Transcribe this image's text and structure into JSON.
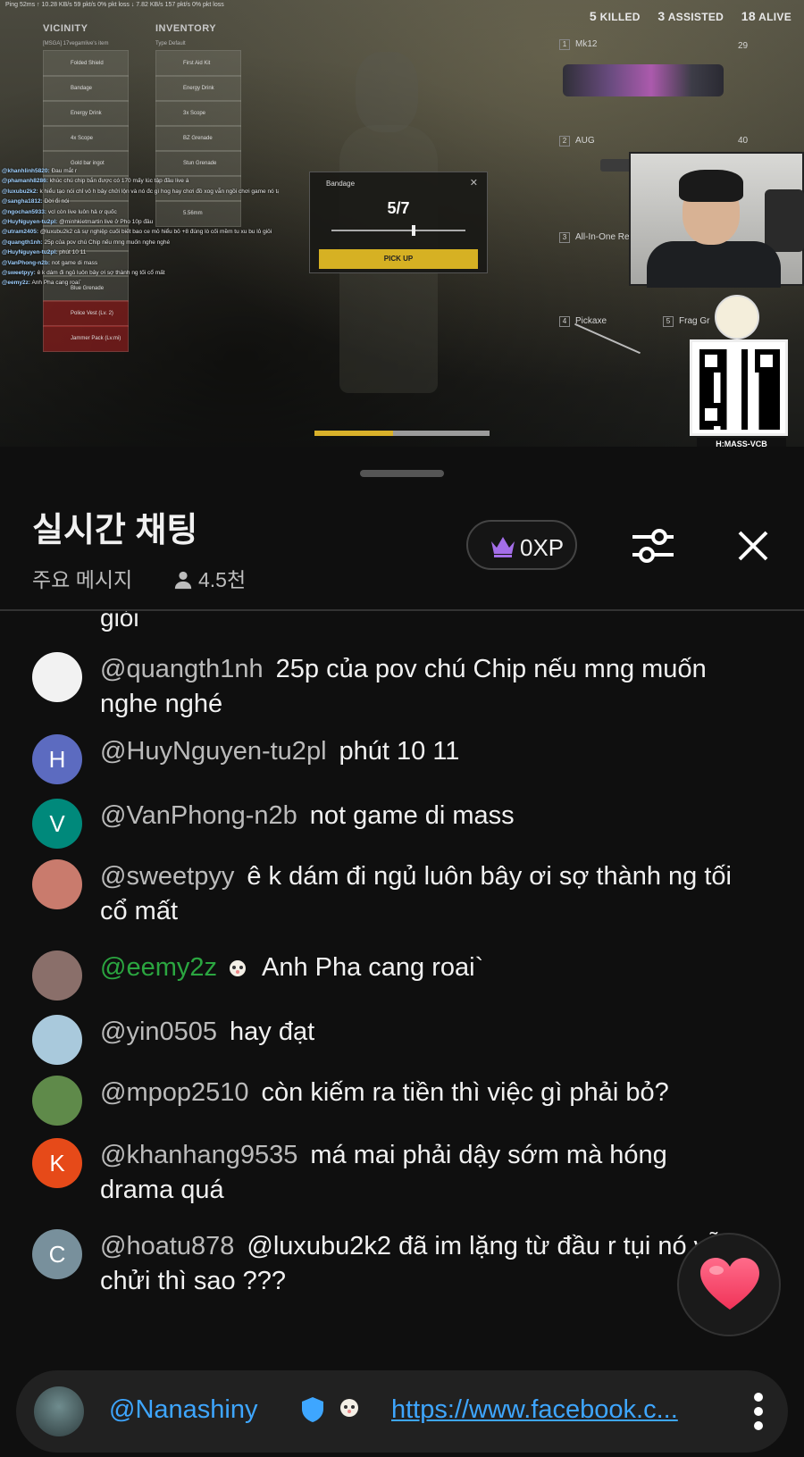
{
  "stream": {
    "hud_top": "Ping 52ms   ↑ 10.28 KB/s  59 pkt/s  0% pkt loss   ↓ 7.82 KB/s  157 pkt/s  0% pkt loss",
    "killed": "5",
    "killed_label": "KILLED",
    "assisted": "3",
    "assisted_label": "ASSISTED",
    "alive": "18",
    "alive_label": "ALIVE",
    "vicinity_title": "VICINITY",
    "vicinity_sub": "[MSGA] 17vegamlive's item",
    "inventory_title": "INVENTORY",
    "inventory_sub": "Type  Default",
    "vicinity_items": [
      "Folded Shield",
      "Bandage",
      "Energy Drink",
      "4x Scope",
      "Gold bar ingot",
      "",
      "",
      "",
      "",
      "Blue Grenade",
      "Police Vest (Lv. 2)",
      "Jammer Pack (Lv.mi)"
    ],
    "inventory_items": [
      "First Aid Kit",
      "Energy Drink",
      "3x Scope",
      "BZ Grenade",
      "Stun Grenade",
      "",
      "5.56mm"
    ],
    "dialog_title": "Bandage",
    "dialog_close": "✕",
    "dialog_count": "5/7",
    "dialog_button": "PICK UP",
    "weapon1_num": "1",
    "weapon1_name": "Mk12",
    "weapon1_ammo": "29",
    "weapon2_num": "2",
    "weapon2_name": "AUG",
    "weapon2_ammo": "40",
    "weapon3_num": "3",
    "weapon3_name": "All-In-One Rep",
    "weapon4_num": "4",
    "weapon4_name": "Pickaxe",
    "weapon5_num": "5",
    "weapon5_name": "Frag Gr",
    "qr_caption": "H:MASS-VCB",
    "pickup_progress": 0.45
  },
  "overlay_chat": [
    {
      "user": "@khanhlinh5820:",
      "text": "Đau mắt r"
    },
    {
      "user": "@phamanh8286:",
      "text": "khúc chú chip bắn được có 170 mấy lúc tập đầu live á"
    },
    {
      "user": "@luxubu2k2:",
      "text": "k hiểu tạo nói chỉ vô h bây chửi lộn và nó đc gì hog hay chơi đồ xog vẫn ngồi chơi game nó tạo ra , đủ chi"
    },
    {
      "user": "@sangha1812:",
      "text": "Dời ổi nói"
    },
    {
      "user": "@ngochan5933:",
      "text": "vcl còn live luôn hả ơ quốc"
    },
    {
      "user": "@HuyNguyen-tu2pl:",
      "text": "@minhkietmartin live ở Pho 10p đầu"
    },
    {
      "user": "@utram2405:",
      "text": "@luxubu2k2 cả sự nghiệp cuối biết bao ce mỏ hiểu bỏ +8 đúng lò cối mềm tu xu bu lỏ giỏi"
    },
    {
      "user": "@quangth1nh:",
      "text": "25p của pov chú Chip nếu mng muốn nghe nghé"
    },
    {
      "user": "@HuyNguyen-tu2pl:",
      "text": "phút 10 11"
    },
    {
      "user": "@VanPhong-n2b:",
      "text": "not game di mass"
    },
    {
      "user": "@sweetpyy:",
      "text": "ê k dám đi ngủ luôn bây ơi sợ thành ng tối cổ mất"
    },
    {
      "user": "@eemy2z:",
      "text": "Anh Pha cang roai`"
    }
  ],
  "chat_panel": {
    "title": "실시간 채팅",
    "mode": "주요 메시지",
    "viewers": "4.5천",
    "xp": "0XP",
    "partial_top_text": "giỏi",
    "accent": "#2ba640",
    "link_color": "#3ea6ff"
  },
  "messages": [
    {
      "author": "@quangth1nh",
      "text": "25p của pov chú Chip nếu mng muốn nghe nghé",
      "avatar": "",
      "avatar_color": "#f2f2f2",
      "member": false
    },
    {
      "author": "@HuyNguyen-tu2pl",
      "text": "phút 10 11",
      "avatar": "H",
      "avatar_color": "#5c6bc0",
      "member": false
    },
    {
      "author": "@VanPhong-n2b",
      "text": "not game di mass",
      "avatar": "V",
      "avatar_color": "#00897b",
      "member": false
    },
    {
      "author": "@sweetpyy",
      "text": "ê k dám đi ngủ luôn bây ơi sợ thành ng tối cổ mất",
      "avatar": "",
      "avatar_color": "#c97b6d",
      "member": false
    },
    {
      "author": "@eemy2z",
      "text": "Anh Pha cang roai`",
      "avatar": "",
      "avatar_color": "#8a6f6a",
      "member": true
    },
    {
      "author": "@yin0505",
      "text": "hay đạt",
      "avatar": "",
      "avatar_color": "#a9c9dc",
      "member": false
    },
    {
      "author": "@mpop2510",
      "text": "còn kiếm ra tiền thì việc gì phải bỏ?",
      "avatar": "",
      "avatar_color": "#5f8a4a",
      "member": false
    },
    {
      "author": "@khanhang9535",
      "text": "má mai phải dậy sớm mà hóng drama quá",
      "avatar": "K",
      "avatar_color": "#e64a19",
      "member": false
    },
    {
      "author": "@hoatu878",
      "text": "@luxubu2k2 đã im lặng từ đầu r tụi nó vẫn chửi thì sao ???",
      "avatar": "C",
      "avatar_color": "#78909c",
      "member": false
    }
  ],
  "composer": {
    "name": "@Nanashiny",
    "link": "https://www.facebook.c..."
  },
  "icons": {
    "crown": "crown-icon",
    "tune": "tune-icon",
    "close": "close-icon",
    "heart": "heart-icon",
    "verified": "verified-icon",
    "more": "more-vertical-icon",
    "person": "person-icon"
  }
}
